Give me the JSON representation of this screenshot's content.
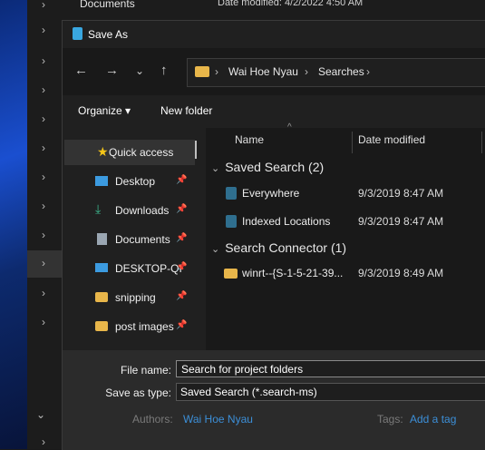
{
  "background": {
    "tree_item_label": "Documents",
    "date_modified": "Date modified: 4/2/2022 4:50 AM"
  },
  "dialog": {
    "title": "Save As",
    "breadcrumbs": [
      "Wai Hoe Nyau",
      "Searches"
    ],
    "toolbar": {
      "organize": "Organize ▾",
      "new_folder": "New folder"
    },
    "nav_pane": [
      {
        "label": "Quick access",
        "icon": "star-icon",
        "color": "#f5c518",
        "pinned": false
      },
      {
        "label": "Desktop",
        "icon": "desktop-icon",
        "color": "#3c9be0",
        "pinned": true
      },
      {
        "label": "Downloads",
        "icon": "download-icon",
        "color": "#3cb48c",
        "pinned": true
      },
      {
        "label": "Documents",
        "icon": "documents-icon",
        "color": "#9aa6b2",
        "pinned": true
      },
      {
        "label": "DESKTOP-QI",
        "icon": "computer-icon",
        "color": "#3c9be0",
        "pinned": true
      },
      {
        "label": "snipping",
        "icon": "folder-icon",
        "color": "#e8b64a",
        "pinned": true
      },
      {
        "label": "post images",
        "icon": "folder-icon",
        "color": "#e8b64a",
        "pinned": true
      }
    ],
    "columns": {
      "name": "Name",
      "date_modified": "Date modified"
    },
    "groups": [
      {
        "title": "Saved Search (2)",
        "items": [
          {
            "name": "Everywhere",
            "date": "9/3/2019 8:47 AM",
            "icon": "saved-search-icon"
          },
          {
            "name": "Indexed Locations",
            "date": "9/3/2019 8:47 AM",
            "icon": "saved-search-icon"
          }
        ]
      },
      {
        "title": "Search Connector (1)",
        "items": [
          {
            "name": "winrt--{S-1-5-21-39...",
            "date": "9/3/2019 8:49 AM",
            "icon": "search-connector-icon"
          }
        ]
      }
    ],
    "file_name_label": "File name:",
    "file_name_value": "Search for project folders",
    "save_type_label": "Save as type:",
    "save_type_value": "Saved Search (*.search-ms)",
    "authors_label": "Authors:",
    "authors_value": "Wai Hoe Nyau",
    "tags_label": "Tags:",
    "tags_value": "Add a tag"
  },
  "colors": {
    "accent": "#3c8fd8",
    "folder": "#e8b64a"
  }
}
